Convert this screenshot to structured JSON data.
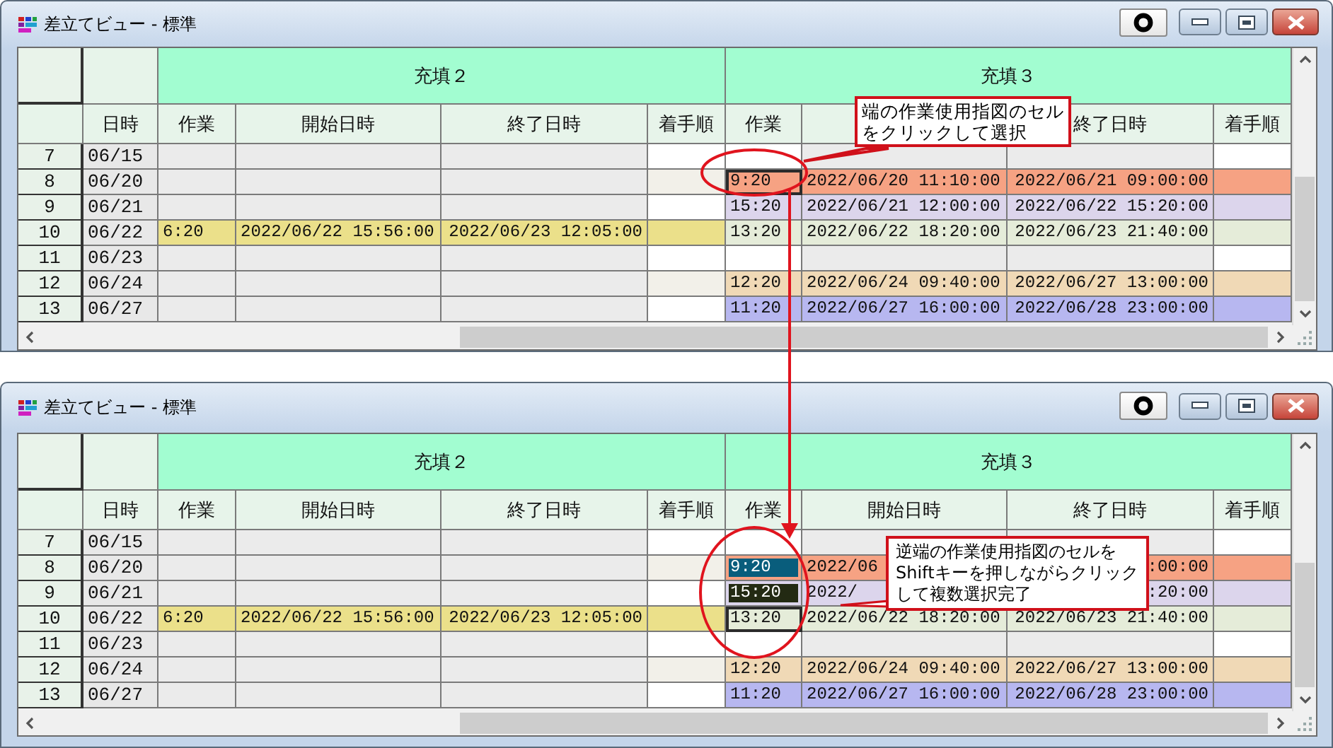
{
  "windows": [
    {
      "title": "差立てビュー - 標準",
      "date_column": "日時",
      "groups": [
        {
          "label": "充填２",
          "columns": [
            {
              "label": "作業"
            },
            {
              "label": "開始日時"
            },
            {
              "label": "終了日時"
            },
            {
              "label": "着手順"
            }
          ]
        },
        {
          "label": "充填３",
          "columns": [
            {
              "label": "作業"
            },
            {},
            {
              "label": "終了日時"
            },
            {
              "label": "着手順"
            }
          ]
        }
      ],
      "rows": [
        {
          "number": "7",
          "date": "06/15",
          "cells": [
            {
              "color": "#ebebeb",
              "selected": false,
              "focused": false
            },
            {
              "color": "#ebebeb",
              "selected": false,
              "focused": false
            },
            {
              "color": "#ebebeb",
              "selected": false,
              "focused": false
            },
            {
              "color": "#ffffff",
              "selected": false,
              "focused": false
            },
            {
              "color": "#ffffff",
              "selected": false,
              "focused": false
            },
            {
              "color": "#ebebeb",
              "selected": false,
              "focused": false
            },
            {
              "color": "#ebebeb",
              "selected": false,
              "focused": false
            },
            {
              "color": "#ffffff",
              "selected": false,
              "focused": false
            }
          ]
        },
        {
          "number": "8",
          "date": "06/20",
          "cells": [
            {
              "color": "#ebebeb",
              "selected": false,
              "focused": false
            },
            {
              "color": "#ebebeb",
              "selected": false,
              "focused": false
            },
            {
              "color": "#ebebeb",
              "selected": false,
              "focused": false
            },
            {
              "color": "#f2f0e9",
              "selected": false,
              "focused": false
            },
            {
              "text": "9:20",
              "color": "#f6a283",
              "selected": false,
              "focused": true
            },
            {
              "text": "2022/06/20 11:10:00",
              "color": "#f6a283",
              "selected": false,
              "focused": false
            },
            {
              "text": "2022/06/21 09:00:00",
              "color": "#f6a283",
              "selected": false,
              "focused": false
            },
            {
              "color": "#f6a283",
              "selected": false,
              "focused": false
            }
          ]
        },
        {
          "number": "9",
          "date": "06/21",
          "cells": [
            {
              "color": "#ebebeb",
              "selected": false,
              "focused": false
            },
            {
              "color": "#ebebeb",
              "selected": false,
              "focused": false
            },
            {
              "color": "#ebebeb",
              "selected": false,
              "focused": false
            },
            {
              "color": "#ffffff",
              "selected": false,
              "focused": false
            },
            {
              "text": "15:20",
              "color": "#dcd5ec",
              "selected": false,
              "focused": false
            },
            {
              "text": "2022/06/21 12:00:00",
              "color": "#dcd5ec",
              "selected": false,
              "focused": false
            },
            {
              "text": "2022/06/22 15:20:00",
              "color": "#dcd5ec",
              "selected": false,
              "focused": false
            },
            {
              "color": "#dcd5ec",
              "selected": false,
              "focused": false
            }
          ]
        },
        {
          "number": "10",
          "date": "06/22",
          "cells": [
            {
              "text": "6:20",
              "color": "#ebe08a",
              "selected": false,
              "focused": false
            },
            {
              "text": "2022/06/22 15:56:00",
              "color": "#ebe08a",
              "selected": false,
              "focused": false
            },
            {
              "text": "2022/06/23 12:05:00",
              "color": "#ebe08a",
              "selected": false,
              "focused": false
            },
            {
              "color": "#ebe08a",
              "selected": false,
              "focused": false
            },
            {
              "text": "13:20",
              "color": "#e5ecd9",
              "selected": false,
              "focused": false
            },
            {
              "text": "2022/06/22 18:20:00",
              "color": "#e5ecd9",
              "selected": false,
              "focused": false
            },
            {
              "text": "2022/06/23 21:40:00",
              "color": "#e5ecd9",
              "selected": false,
              "focused": false
            },
            {
              "color": "#e5ecd9",
              "selected": false,
              "focused": false
            }
          ]
        },
        {
          "number": "11",
          "date": "06/23",
          "cells": [
            {
              "color": "#ebebeb",
              "selected": false,
              "focused": false
            },
            {
              "color": "#ebebeb",
              "selected": false,
              "focused": false
            },
            {
              "color": "#ebebeb",
              "selected": false,
              "focused": false
            },
            {
              "color": "#ffffff",
              "selected": false,
              "focused": false
            },
            {
              "color": "#ffffff",
              "selected": false,
              "focused": false
            },
            {
              "color": "#ebebeb",
              "selected": false,
              "focused": false
            },
            {
              "color": "#ebebeb",
              "selected": false,
              "focused": false
            },
            {
              "color": "#ffffff",
              "selected": false,
              "focused": false
            }
          ]
        },
        {
          "number": "12",
          "date": "06/24",
          "cells": [
            {
              "color": "#ebebeb",
              "selected": false,
              "focused": false
            },
            {
              "color": "#ebebeb",
              "selected": false,
              "focused": false
            },
            {
              "color": "#ebebeb",
              "selected": false,
              "focused": false
            },
            {
              "color": "#f2f0e9",
              "selected": false,
              "focused": false
            },
            {
              "text": "12:20",
              "color": "#f0d9b6",
              "selected": false,
              "focused": false
            },
            {
              "text": "2022/06/24 09:40:00",
              "color": "#f0d9b6",
              "selected": false,
              "focused": false
            },
            {
              "text": "2022/06/27 13:00:00",
              "color": "#f0d9b6",
              "selected": false,
              "focused": false
            },
            {
              "color": "#f0d9b6",
              "selected": false,
              "focused": false
            }
          ]
        },
        {
          "number": "13",
          "date": "06/27",
          "cells": [
            {
              "color": "#ebebeb",
              "selected": false,
              "focused": false
            },
            {
              "color": "#ebebeb",
              "selected": false,
              "focused": false
            },
            {
              "color": "#ebebeb",
              "selected": false,
              "focused": false
            },
            {
              "color": "#ffffff",
              "selected": false,
              "focused": false
            },
            {
              "text": "11:20",
              "color": "#b7b7f0",
              "selected": false,
              "focused": false
            },
            {
              "text": "2022/06/27 16:00:00",
              "color": "#b7b7f0",
              "selected": false,
              "focused": false
            },
            {
              "text": "2022/06/28 23:00:00",
              "color": "#b7b7f0",
              "selected": false,
              "focused": false
            },
            {
              "color": "#b7b7f0",
              "selected": false,
              "focused": false
            }
          ]
        }
      ]
    },
    {
      "title": "差立てビュー - 標準",
      "date_column": "日時",
      "groups": [
        {
          "label": "充填２",
          "columns": [
            {
              "label": "作業"
            },
            {
              "label": "開始日時"
            },
            {
              "label": "終了日時"
            },
            {
              "label": "着手順"
            }
          ]
        },
        {
          "label": "充填３",
          "columns": [
            {
              "label": "作業"
            },
            {
              "label": "開始日時"
            },
            {
              "label": "終了日時"
            },
            {
              "label": "着手順"
            }
          ]
        }
      ],
      "rows": [
        {
          "number": "7",
          "date": "06/15",
          "cells": [
            {
              "color": "#ebebeb",
              "selected": false,
              "focused": false
            },
            {
              "color": "#ebebeb",
              "selected": false,
              "focused": false
            },
            {
              "color": "#ebebeb",
              "selected": false,
              "focused": false
            },
            {
              "color": "#ffffff",
              "selected": false,
              "focused": false
            },
            {
              "color": "#ffffff",
              "selected": false,
              "focused": false
            },
            {
              "color": "#ebebeb",
              "selected": false,
              "focused": false
            },
            {
              "color": "#ebebeb",
              "selected": false,
              "focused": false
            },
            {
              "color": "#ffffff",
              "selected": false,
              "focused": false
            }
          ]
        },
        {
          "number": "8",
          "date": "06/20",
          "cells": [
            {
              "color": "#ebebeb",
              "selected": false,
              "focused": false
            },
            {
              "color": "#ebebeb",
              "selected": false,
              "focused": false
            },
            {
              "color": "#ebebeb",
              "selected": false,
              "focused": false
            },
            {
              "color": "#f2f0e9",
              "selected": false,
              "focused": false
            },
            {
              "text": "9:20",
              "color": "#f6a283",
              "selected": true,
              "focused": false
            },
            {
              "text": "2022/06",
              "color": "#f6a283",
              "selected": false,
              "focused": false
            },
            {
              "text": ":00:00",
              "color": "#f6a283",
              "selected": false,
              "focused": false
            },
            {
              "color": "#f6a283",
              "selected": false,
              "focused": false
            }
          ]
        },
        {
          "number": "9",
          "date": "06/21",
          "cells": [
            {
              "color": "#ebebeb",
              "selected": false,
              "focused": false
            },
            {
              "color": "#ebebeb",
              "selected": false,
              "focused": false
            },
            {
              "color": "#ebebeb",
              "selected": false,
              "focused": false
            },
            {
              "color": "#ffffff",
              "selected": false,
              "focused": false
            },
            {
              "text": "15:20",
              "color": "#dcd5ec",
              "selected": true,
              "focused": false
            },
            {
              "text": "2022/",
              "color": "#dcd5ec",
              "selected": false,
              "focused": false
            },
            {
              "text": ":20:00",
              "color": "#dcd5ec",
              "selected": false,
              "focused": false
            },
            {
              "color": "#dcd5ec",
              "selected": false,
              "focused": false
            }
          ]
        },
        {
          "number": "10",
          "date": "06/22",
          "cells": [
            {
              "text": "6:20",
              "color": "#ebe08a",
              "selected": false,
              "focused": false
            },
            {
              "text": "2022/06/22 15:56:00",
              "color": "#ebe08a",
              "selected": false,
              "focused": false
            },
            {
              "text": "2022/06/23 12:05:00",
              "color": "#ebe08a",
              "selected": false,
              "focused": false
            },
            {
              "color": "#ebe08a",
              "selected": false,
              "focused": false
            },
            {
              "text": "13:20",
              "color": "#e5ecd9",
              "selected": false,
              "focused": true
            },
            {
              "text": "2022/06/22 18:20:00",
              "color": "#e5ecd9",
              "selected": false,
              "focused": false
            },
            {
              "text": "2022/06/23 21:40:00",
              "color": "#e5ecd9",
              "selected": false,
              "focused": false
            },
            {
              "color": "#e5ecd9",
              "selected": false,
              "focused": false
            }
          ]
        },
        {
          "number": "11",
          "date": "06/23",
          "cells": [
            {
              "color": "#ebebeb",
              "selected": false,
              "focused": false
            },
            {
              "color": "#ebebeb",
              "selected": false,
              "focused": false
            },
            {
              "color": "#ebebeb",
              "selected": false,
              "focused": false
            },
            {
              "color": "#ffffff",
              "selected": false,
              "focused": false
            },
            {
              "color": "#ffffff",
              "selected": false,
              "focused": false
            },
            {
              "color": "#ebebeb",
              "selected": false,
              "focused": false
            },
            {
              "color": "#ebebeb",
              "selected": false,
              "focused": false
            },
            {
              "color": "#ffffff",
              "selected": false,
              "focused": false
            }
          ]
        },
        {
          "number": "12",
          "date": "06/24",
          "cells": [
            {
              "color": "#ebebeb",
              "selected": false,
              "focused": false
            },
            {
              "color": "#ebebeb",
              "selected": false,
              "focused": false
            },
            {
              "color": "#ebebeb",
              "selected": false,
              "focused": false
            },
            {
              "color": "#f2f0e9",
              "selected": false,
              "focused": false
            },
            {
              "text": "12:20",
              "color": "#f0d9b6",
              "selected": false,
              "focused": false
            },
            {
              "text": "2022/06/24 09:40:00",
              "color": "#f0d9b6",
              "selected": false,
              "focused": false
            },
            {
              "text": "2022/06/27 13:00:00",
              "color": "#f0d9b6",
              "selected": false,
              "focused": false
            },
            {
              "color": "#f0d9b6",
              "selected": false,
              "focused": false
            }
          ]
        },
        {
          "number": "13",
          "date": "06/27",
          "cells": [
            {
              "color": "#ebebeb",
              "selected": false,
              "focused": false
            },
            {
              "color": "#ebebeb",
              "selected": false,
              "focused": false
            },
            {
              "color": "#ebebeb",
              "selected": false,
              "focused": false
            },
            {
              "color": "#ffffff",
              "selected": false,
              "focused": false
            },
            {
              "text": "11:20",
              "color": "#b7b7f0",
              "selected": false,
              "focused": false
            },
            {
              "text": "2022/06/27 16:00:00",
              "color": "#b7b7f0",
              "selected": false,
              "focused": false
            },
            {
              "text": "2022/06/28 23:00:00",
              "color": "#b7b7f0",
              "selected": false,
              "focused": false
            },
            {
              "color": "#b7b7f0",
              "selected": false,
              "focused": false
            }
          ]
        }
      ]
    }
  ],
  "annotations": [
    {
      "text": "端の作業使用指図のセルをクリックして選択"
    },
    {
      "text": "逆端の作業使用指図のセルをShiftキーを押しながらクリックして複数選択完了"
    }
  ]
}
